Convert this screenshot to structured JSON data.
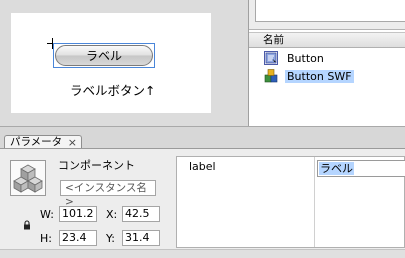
{
  "stage": {
    "button_label": "ラベル",
    "annotation": "ラベルボタン↑"
  },
  "library": {
    "column_header": "名前",
    "items": [
      {
        "label": "Button",
        "icon": "button-symbol-icon",
        "selected": false
      },
      {
        "label": "Button SWF",
        "icon": "component-swf-icon",
        "selected": true
      }
    ]
  },
  "inspector": {
    "tab_label": "パラメータ",
    "tab_close": "×",
    "component_type": "コンポーネント",
    "instance_name_placeholder": "<インスタンス名>",
    "w_label": "W:",
    "w_value": "101.2",
    "x_label": "X:",
    "x_value": "42.5",
    "h_label": "H:",
    "h_value": "23.4",
    "y_label": "Y:",
    "y_value": "31.4",
    "params": [
      {
        "name": "label",
        "value": "ラベル"
      }
    ]
  },
  "colors": {
    "selection": "#4a86d9",
    "highlight": "#b5d5ff"
  }
}
